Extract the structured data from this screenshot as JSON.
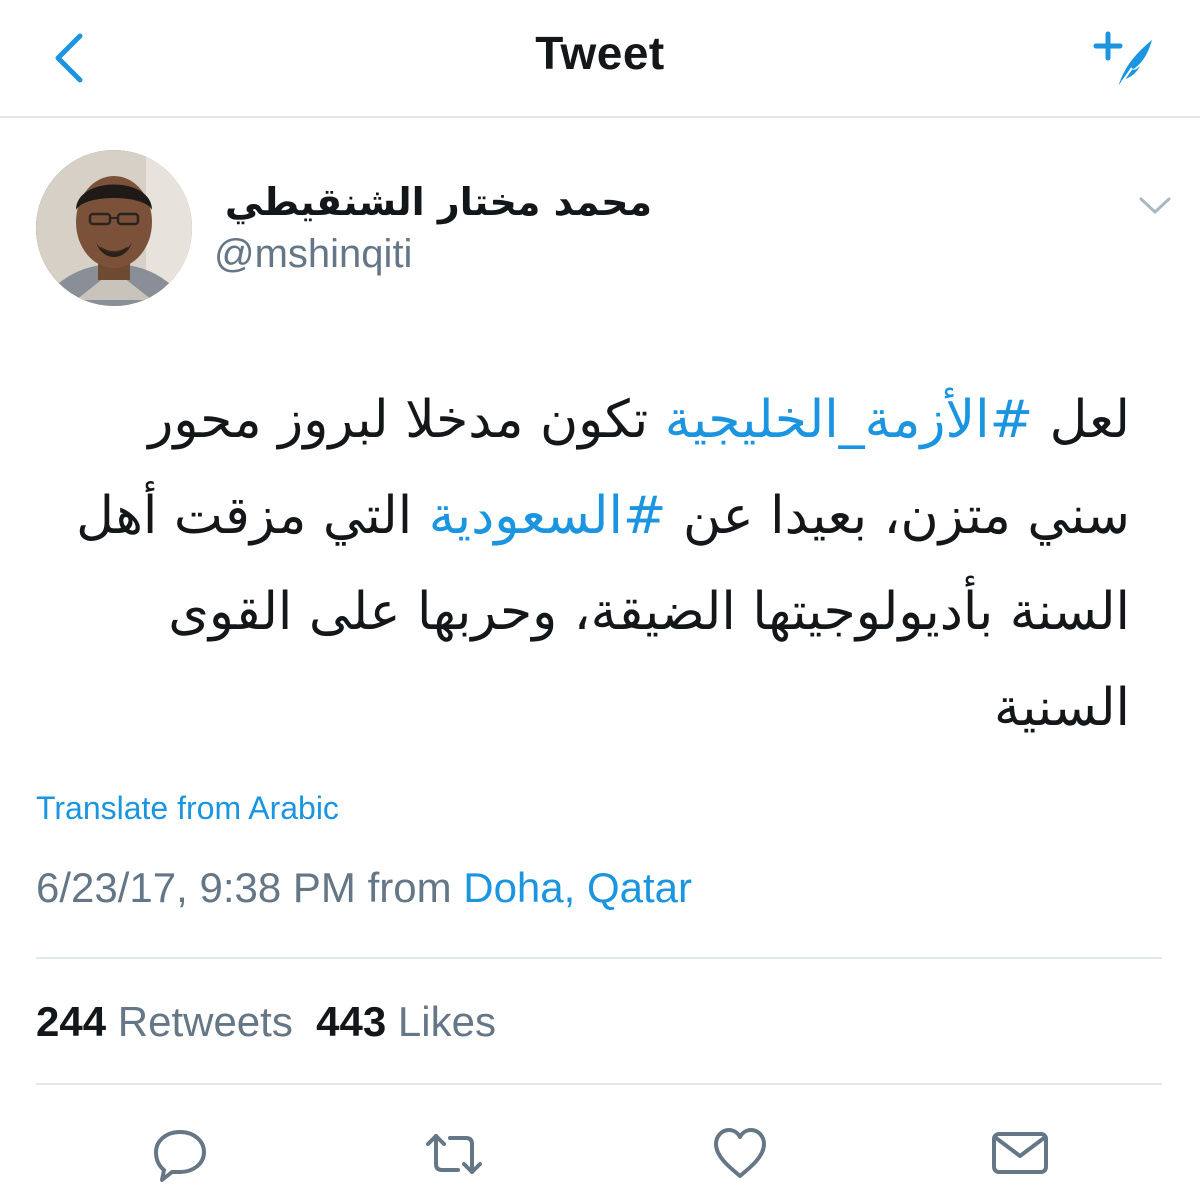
{
  "nav": {
    "title": "Tweet",
    "back_icon": "chevron-left-icon",
    "compose_icon": "compose-tweet-icon",
    "accent_color": "#1b95e0"
  },
  "author": {
    "name": "محمد مختار الشنقيطي",
    "handle": "@mshinqiti"
  },
  "tweet": {
    "lines": [
      {
        "pre": "لعل ",
        "tag": "#الأزمة_الخليجية",
        "post": " تكون مدخلا لبروز محور"
      },
      {
        "pre": "سني متزن، بعيدا عن ",
        "tag": "#السعودية",
        "post": " التي مزقت أهل"
      },
      {
        "pre": "السنة بأديولوجيتها الضيقة، وحربها على القوى",
        "tag": "",
        "post": ""
      },
      {
        "pre": "السنية",
        "tag": "",
        "post": ""
      }
    ],
    "translate_label": "Translate from Arabic",
    "timestamp": "6/23/17, 9:38 PM",
    "from_label": "from",
    "location": "Doha, Qatar"
  },
  "stats": {
    "retweets_count": "244",
    "retweets_label": "Retweets",
    "likes_count": "443",
    "likes_label": "Likes"
  },
  "actions": [
    {
      "name": "reply-icon"
    },
    {
      "name": "retweet-icon"
    },
    {
      "name": "like-icon"
    },
    {
      "name": "direct-message-icon"
    }
  ],
  "colors": {
    "text": "#14171a",
    "secondary": "#657786",
    "link": "#1b95e0",
    "divider": "#e1e8ed"
  }
}
